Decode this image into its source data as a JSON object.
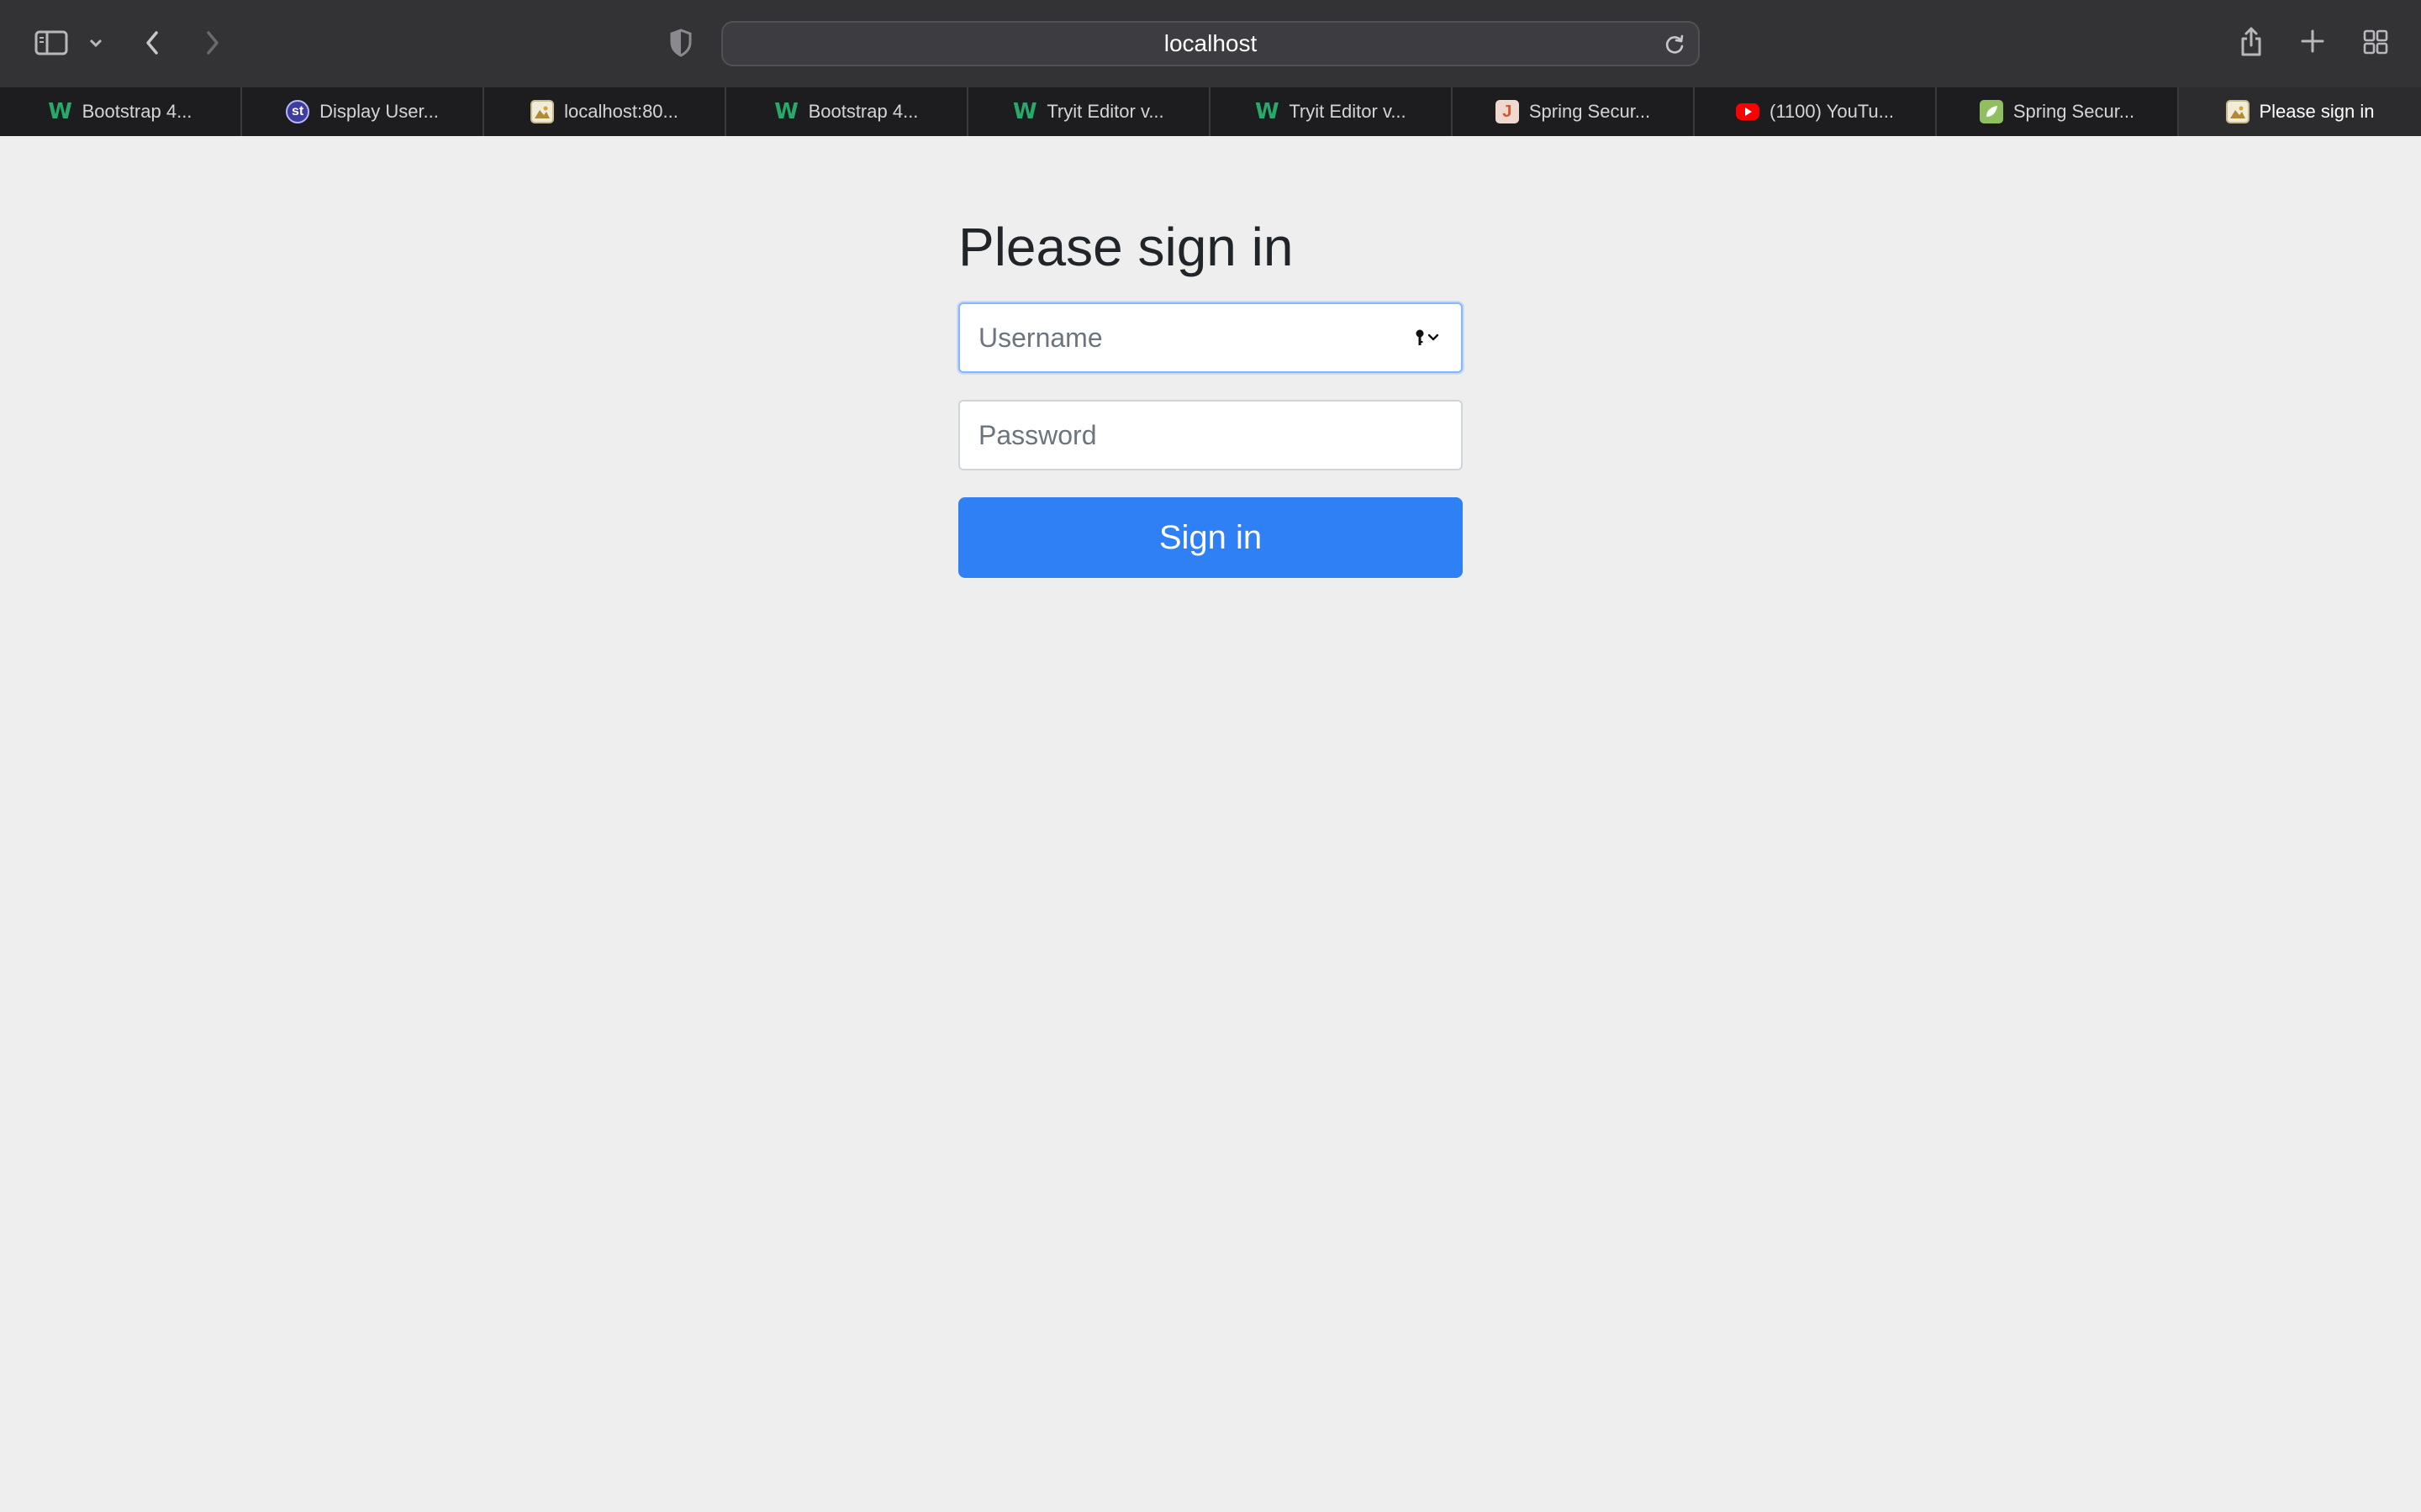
{
  "browser": {
    "address": "localhost",
    "tabs": [
      {
        "label": "Bootstrap 4...",
        "favicon": "w3schools-icon"
      },
      {
        "label": "Display User...",
        "favicon": "studytonight-icon"
      },
      {
        "label": "localhost:80...",
        "favicon": "image-icon"
      },
      {
        "label": "Bootstrap 4...",
        "favicon": "w3schools-icon"
      },
      {
        "label": "Tryit Editor v...",
        "favicon": "w3schools-icon"
      },
      {
        "label": "Tryit Editor v...",
        "favicon": "w3schools-icon"
      },
      {
        "label": "Spring Secur...",
        "favicon": "j-icon"
      },
      {
        "label": "(1100) YouTu...",
        "favicon": "youtube-icon"
      },
      {
        "label": "Spring Secur...",
        "favicon": "spring-icon"
      },
      {
        "label": "Please sign in",
        "favicon": "image-icon",
        "active": true
      }
    ]
  },
  "form": {
    "heading": "Please sign in",
    "username_placeholder": "Username",
    "username_value": "",
    "password_placeholder": "Password",
    "password_value": "",
    "submit_label": "Sign in"
  },
  "colors": {
    "primary_button": "#2f7ff5",
    "page_background": "#eeeeee",
    "toolbar": "#333336"
  }
}
